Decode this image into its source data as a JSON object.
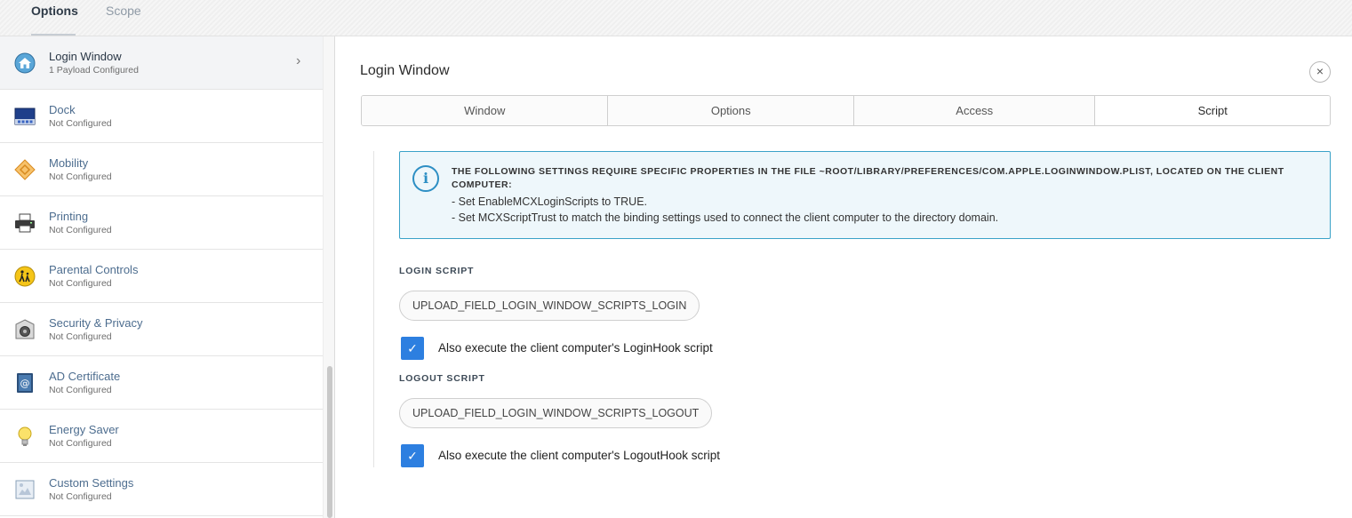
{
  "top_tabs": [
    {
      "label": "Options",
      "active": true
    },
    {
      "label": "Scope",
      "active": false
    }
  ],
  "sidebar": {
    "items": [
      {
        "title": "Login Window",
        "subtitle": "1 Payload Configured",
        "icon": "house-icon",
        "selected": true
      },
      {
        "title": "Dock",
        "subtitle": "Not Configured",
        "icon": "dock-icon"
      },
      {
        "title": "Mobility",
        "subtitle": "Not Configured",
        "icon": "mobility-icon"
      },
      {
        "title": "Printing",
        "subtitle": "Not Configured",
        "icon": "printer-icon"
      },
      {
        "title": "Parental Controls",
        "subtitle": "Not Configured",
        "icon": "parental-controls-icon"
      },
      {
        "title": "Security & Privacy",
        "subtitle": "Not Configured",
        "icon": "security-icon"
      },
      {
        "title": "AD Certificate",
        "subtitle": "Not Configured",
        "icon": "certificate-icon"
      },
      {
        "title": "Energy Saver",
        "subtitle": "Not Configured",
        "icon": "lightbulb-icon"
      },
      {
        "title": "Custom Settings",
        "subtitle": "Not Configured",
        "icon": "custom-settings-icon"
      }
    ]
  },
  "panel": {
    "title": "Login Window",
    "close_symbol": "×",
    "tabs": [
      {
        "label": "Window",
        "active": false
      },
      {
        "label": "Options",
        "active": false
      },
      {
        "label": "Access",
        "active": false
      },
      {
        "label": "Script",
        "active": true
      }
    ],
    "info": {
      "heading": "THE FOLLOWING SETTINGS REQUIRE SPECIFIC PROPERTIES IN THE FILE ~ROOT/LIBRARY/PREFERENCES/COM.APPLE.LOGINWINDOW.PLIST, LOCATED ON THE CLIENT COMPUTER:",
      "line1": "- Set EnableMCXLoginScripts to TRUE.",
      "line2": "- Set MCXScriptTrust to match the binding settings used to connect the client computer to the directory domain."
    },
    "login_script": {
      "label": "LOGIN SCRIPT",
      "upload": "UPLOAD_FIELD_LOGIN_WINDOW_SCRIPTS_LOGIN",
      "checkbox_label": "Also execute the client computer's LoginHook script",
      "checked": true
    },
    "logout_script": {
      "label": "LOGOUT SCRIPT",
      "upload": "UPLOAD_FIELD_LOGIN_WINDOW_SCRIPTS_LOGOUT",
      "checkbox_label": "Also execute the client computer's LogoutHook script",
      "checked": true
    }
  },
  "colors": {
    "accent": "#2d7fe0",
    "info_border": "#3aa2c8",
    "sidebar_title": "#4d6d8f"
  }
}
